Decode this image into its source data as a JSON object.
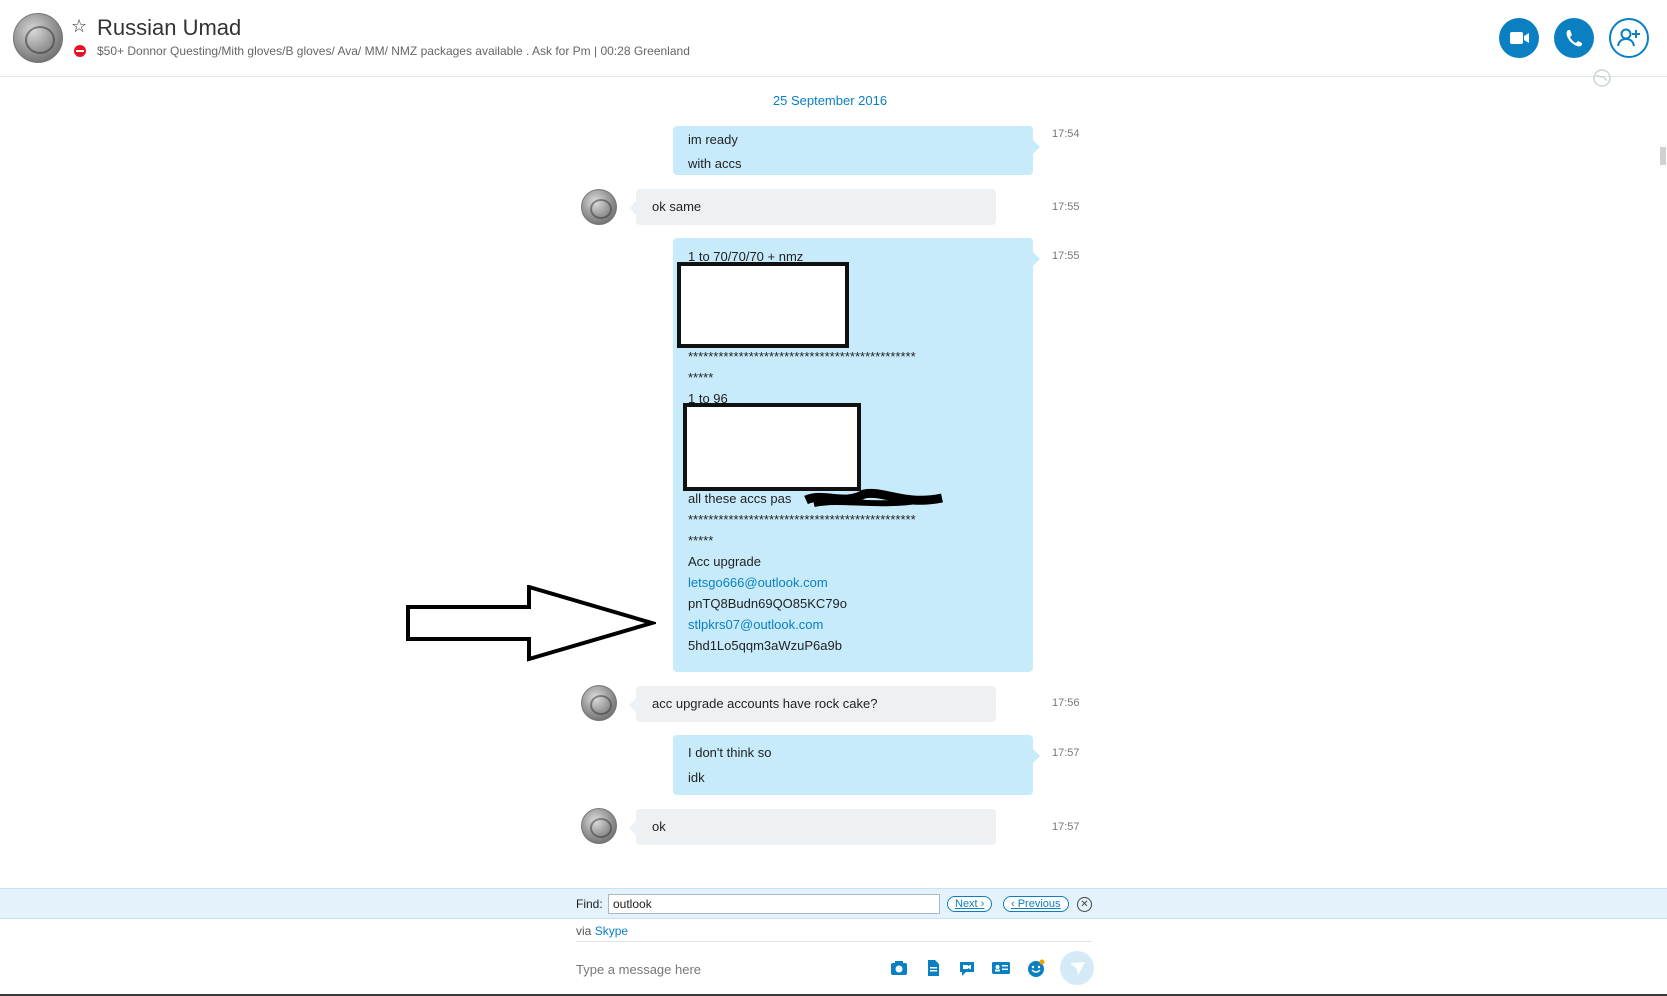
{
  "header": {
    "contact_name": "Russian Umad",
    "mood": "$50+ Donnor Questing/Mith gloves/B gloves/ Ava/ MM/ NMZ packages available  . Ask for Pm  |  00:28 Greenland",
    "buttons": [
      "video-call",
      "voice-call",
      "add-people"
    ]
  },
  "chat": {
    "date_separator": "25 September 2016",
    "messages": [
      {
        "dir": "out",
        "lines": [
          "im ready",
          "with accs"
        ],
        "time": "17:54"
      },
      {
        "dir": "in",
        "text": "ok same",
        "time": "17:55"
      },
      {
        "dir": "out",
        "time": "17:55",
        "lines": {
          "l1": "1 to 70/70/70 + nmz",
          "stars1": "*********************************************",
          "stars1b": "*****",
          "l2": "1 to 96",
          "l3": "all these accs pas",
          "stars2": "*********************************************",
          "stars2b": "*****",
          "l4": "Acc upgrade",
          "email1": "letsgo666@outlook.com",
          "pass1": "pnTQ8Budn69QO85KC79o",
          "email2": "stlpkrs07@outlook.com",
          "pass2": "5hd1Lo5qqm3aWzuP6a9b"
        }
      },
      {
        "dir": "in",
        "text": "acc upgrade accounts have rock cake?",
        "time": "17:56"
      },
      {
        "dir": "out",
        "lines": [
          "I don't think so",
          "idk"
        ],
        "time": "17:57"
      },
      {
        "dir": "in",
        "text": "ok",
        "time": "17:57"
      }
    ]
  },
  "find": {
    "label": "Find:",
    "value": "outlook",
    "next_label": "Next ›",
    "prev_label": "‹ Previous"
  },
  "composer": {
    "via_prefix": "via ",
    "via_link": "Skype",
    "placeholder": "Type a message here",
    "tools": [
      "send-photo-icon",
      "send-file-icon",
      "video-message-icon",
      "send-contact-icon",
      "emoticon-icon"
    ]
  },
  "colors": {
    "accent": "#0a7fc2",
    "outgoing_bubble": "#c7ebfb",
    "incoming_bubble": "#eef1f4",
    "status_dnd": "#e81123"
  }
}
